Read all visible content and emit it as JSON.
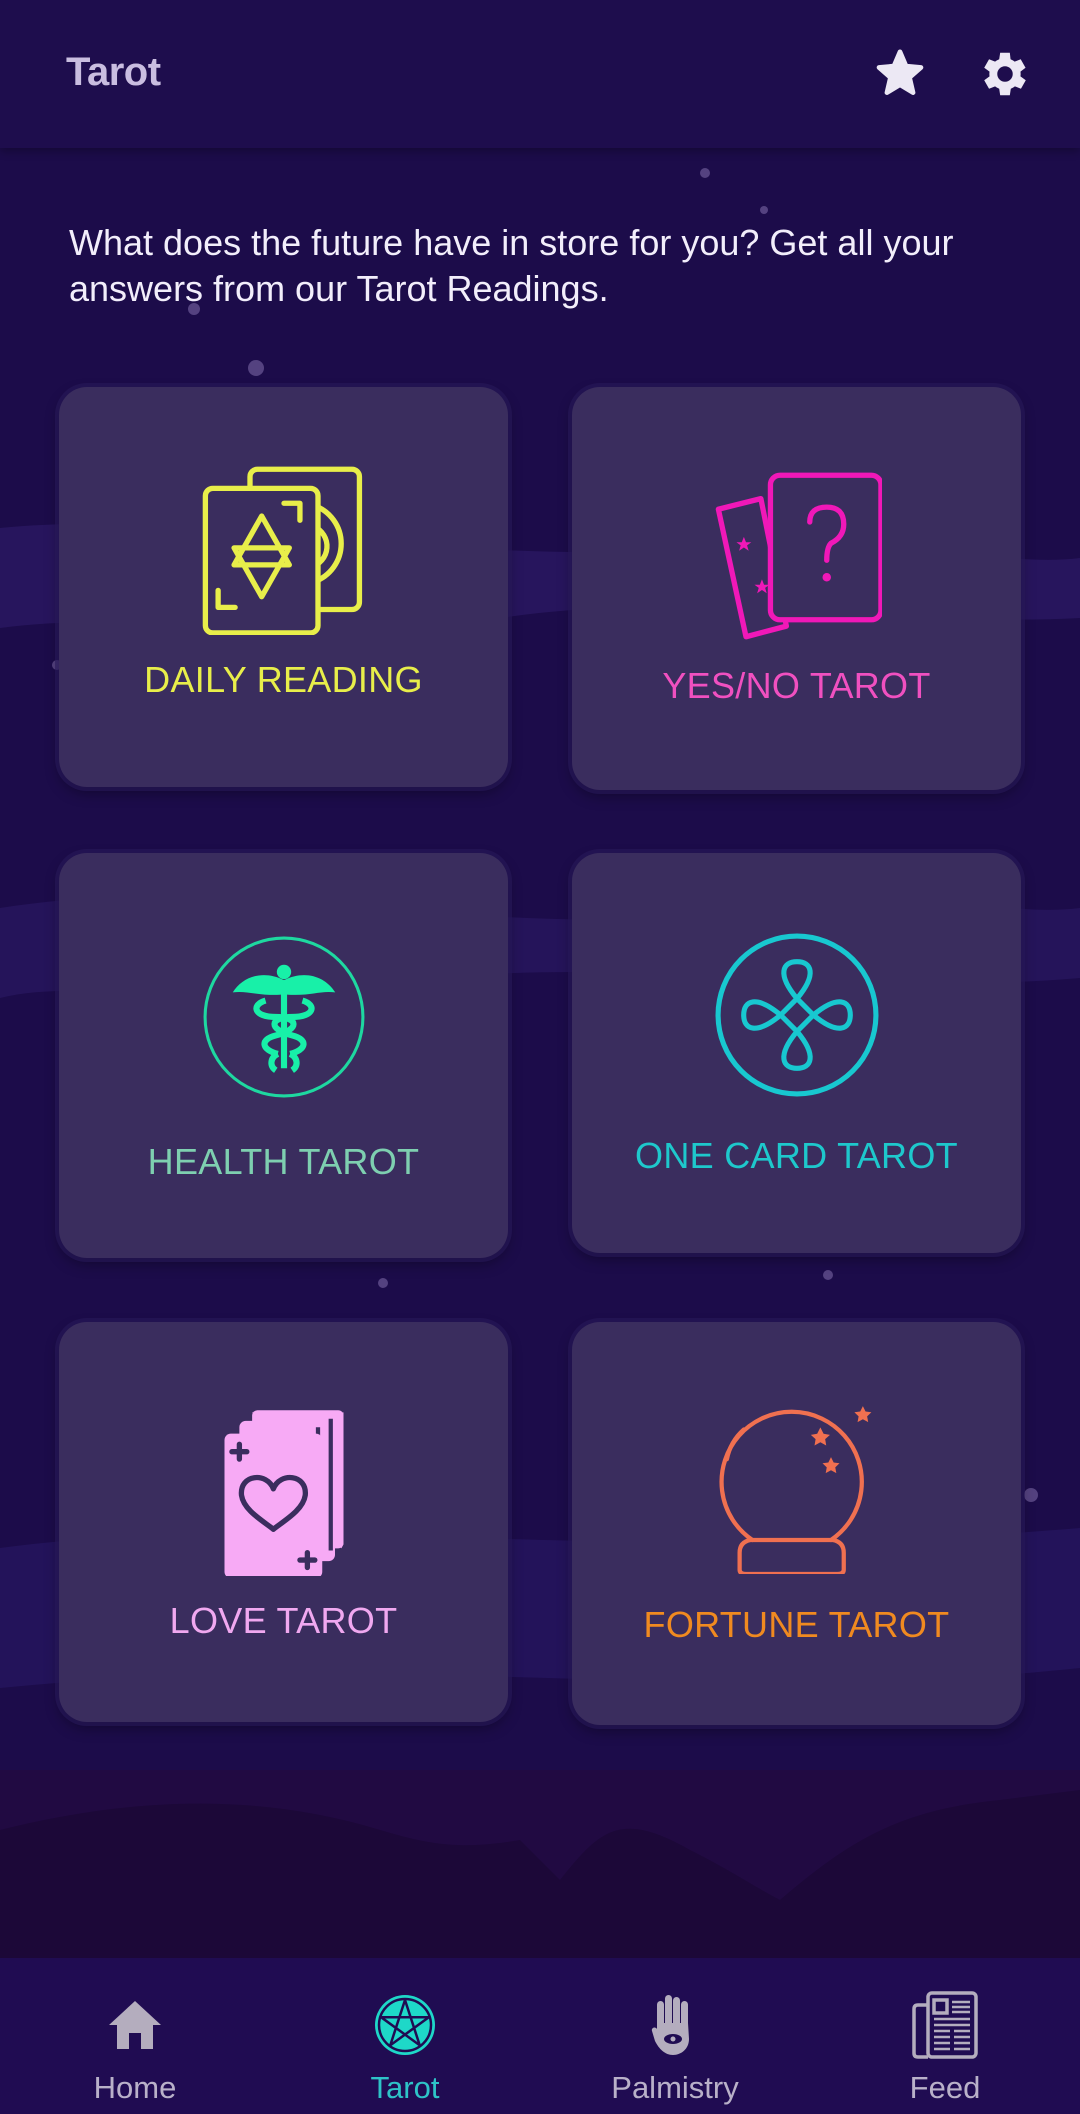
{
  "header": {
    "title": "Tarot",
    "favorites_icon": "star-icon",
    "settings_icon": "gear-icon"
  },
  "intro": {
    "text": "What does the future have in store for you? Get all your answers from our Tarot Readings."
  },
  "cards": [
    {
      "label": "DAILY READING",
      "icon": "tarot-cards-star-icon",
      "color": "#e8ee4a"
    },
    {
      "label": "YES/NO TAROT",
      "icon": "question-cards-icon",
      "color": "#f050c0"
    },
    {
      "label": "HEALTH TAROT",
      "icon": "caduceus-icon",
      "color": "#7ecfb0"
    },
    {
      "label": "ONE CARD TAROT",
      "icon": "celtic-knot-icon",
      "color": "#1ec8cc"
    },
    {
      "label": "LOVE TAROT",
      "icon": "heart-card-deck-icon",
      "color": "#f0a8f0"
    },
    {
      "label": "FORTUNE TAROT",
      "icon": "crystal-ball-icon",
      "color": "#f08a20"
    }
  ],
  "nav": {
    "items": [
      {
        "label": "Home",
        "icon": "home-icon",
        "active": false
      },
      {
        "label": "Tarot",
        "icon": "pentagram-icon",
        "active": true
      },
      {
        "label": "Palmistry",
        "icon": "hamsa-hand-icon",
        "active": false
      },
      {
        "label": "Feed",
        "icon": "newspaper-icon",
        "active": false
      }
    ],
    "active_color": "#2ec4c8",
    "inactive_color": "#b9b1c9"
  }
}
